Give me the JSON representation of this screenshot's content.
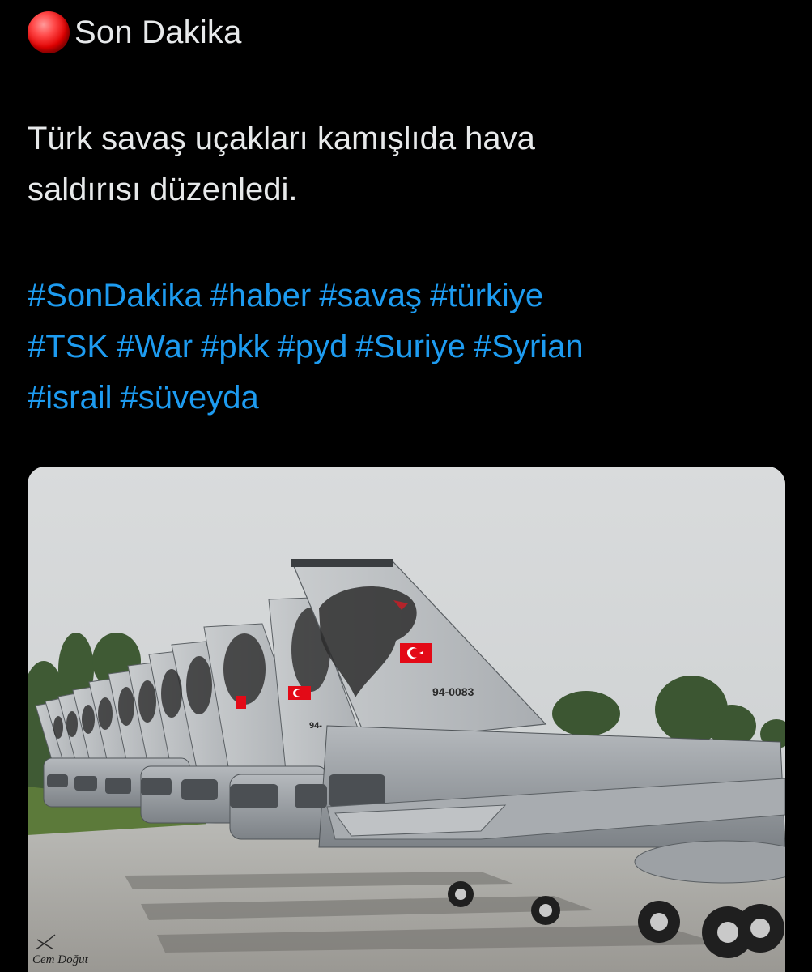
{
  "header": {
    "icon": "red-circle-icon",
    "icon_color": "#e00000",
    "title": "Son Dakika"
  },
  "tweet": {
    "text_lines": [
      "Türk savaş uçakları kamışlıda hava",
      "saldırısı düzenledi."
    ],
    "hashtags": [
      "#SonDakika",
      "#haber",
      "#savaş",
      "#türkiye",
      "#TSK",
      "#War",
      "#pkk",
      "#pyd",
      "#Suriye",
      "#Syrian",
      "#israil",
      "#süveyda"
    ],
    "hashtag_color": "#1d9bf0"
  },
  "media": {
    "tail_number_main": "94-0083",
    "tail_number_partial": "94-",
    "watermark": "Cem Doğut"
  }
}
